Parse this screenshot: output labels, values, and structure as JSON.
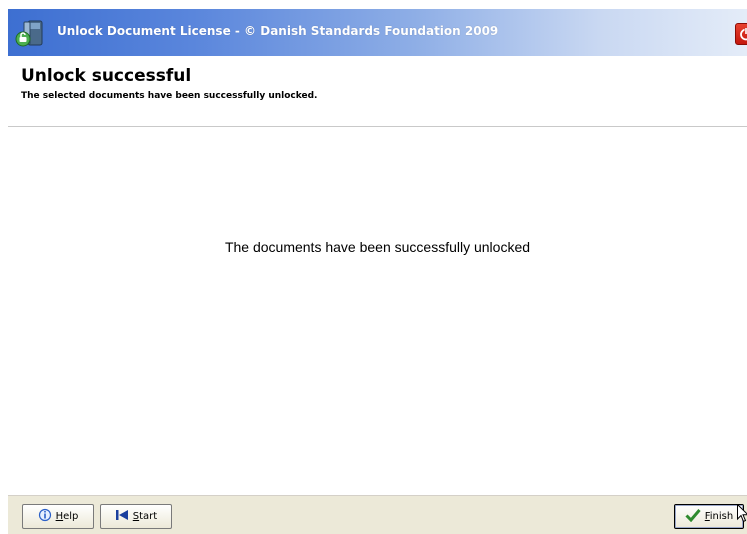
{
  "window": {
    "title": "Unlock Document License - © Danish Standards Foundation 2009",
    "app_icon": "document-unlock-icon",
    "close_icon": "power-close-icon",
    "title_gradient_start": "#3d6fd1",
    "close_color": "#d3261a"
  },
  "header": {
    "title": "Unlock successful",
    "subtitle": "The selected documents have been successfully unlocked."
  },
  "main": {
    "message": "The documents have been successfully unlocked"
  },
  "footer": {
    "help": {
      "label_first": "H",
      "label_rest": "elp",
      "icon": "help-icon"
    },
    "start": {
      "label_first": "S",
      "label_rest": "tart",
      "icon": "skip-back-icon"
    },
    "finish": {
      "label_first": "F",
      "label_rest": "inish",
      "icon": "checkmark-icon"
    }
  }
}
